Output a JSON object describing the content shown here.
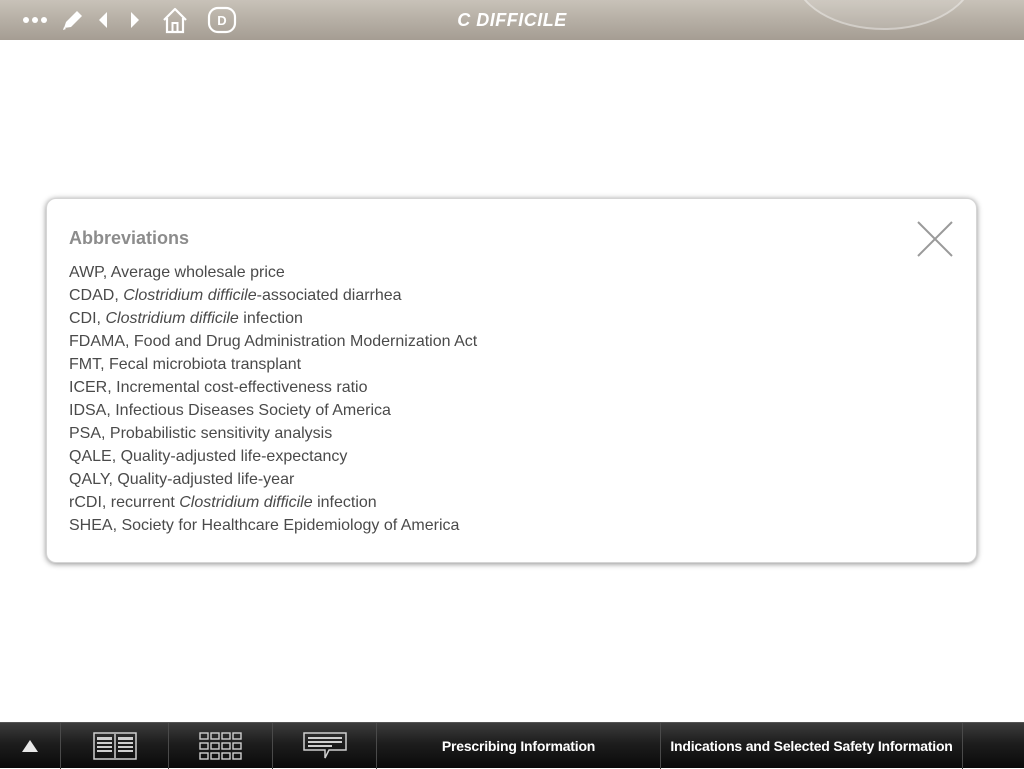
{
  "header": {
    "title": "C DIFFICILE",
    "icons": [
      "more-dots-icon",
      "pen-icon",
      "back-arrow-icon",
      "forward-arrow-icon",
      "home-icon",
      "d-badge-icon"
    ],
    "badge_letter": "D"
  },
  "modal": {
    "heading": "Abbreviations",
    "items": [
      {
        "pre": "AWP, Average wholesale price",
        "ital": "",
        "post": ""
      },
      {
        "pre": "CDAD, ",
        "ital": "Clostridium difficile",
        "post": "-associated diarrhea"
      },
      {
        "pre": "CDI, ",
        "ital": "Clostridium difficile",
        "post": " infection"
      },
      {
        "pre": "FDAMA, Food and Drug Administration Modernization Act",
        "ital": "",
        "post": ""
      },
      {
        "pre": "FMT, Fecal microbiota transplant",
        "ital": "",
        "post": ""
      },
      {
        "pre": "ICER, Incremental cost-effectiveness ratio",
        "ital": "",
        "post": ""
      },
      {
        "pre": "IDSA, Infectious Diseases Society of America",
        "ital": "",
        "post": ""
      },
      {
        "pre": "PSA, Probabilistic sensitivity analysis",
        "ital": "",
        "post": ""
      },
      {
        "pre": "QALE, Quality-adjusted life-expectancy",
        "ital": "",
        "post": ""
      },
      {
        "pre": "QALY, Quality-adjusted life-year",
        "ital": "",
        "post": ""
      },
      {
        "pre": "rCDI, recurrent ",
        "ital": "Clostridium difficile",
        "post": " infection"
      },
      {
        "pre": "SHEA, Society for Healthcare Epidemiology of America",
        "ital": "",
        "post": ""
      }
    ]
  },
  "footer": {
    "icons": [
      "expand-up-icon",
      "book-icon",
      "grid-icon",
      "notes-icon"
    ],
    "prescribing_label": "Prescribing Information",
    "indications_label": "Indications and Selected Safety Information"
  },
  "colors": {
    "topbar": "#b6afa5",
    "bottombar": "#1d1d1d",
    "heading": "#8c8c8c",
    "text": "#4a4a4a"
  }
}
